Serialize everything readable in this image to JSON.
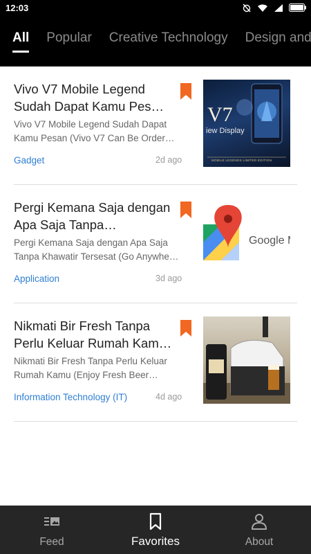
{
  "status_bar": {
    "time": "12:03"
  },
  "tabs": [
    {
      "label": "All",
      "active": true
    },
    {
      "label": "Popular",
      "active": false
    },
    {
      "label": "Creative Technology",
      "active": false
    },
    {
      "label": "Design and",
      "active": false
    }
  ],
  "articles": [
    {
      "title": "Vivo V7 Mobile Legend Sudah Dapat Kamu Pes…",
      "description": "Vivo V7 Mobile Legend Sudah Dapat Kamu Pesan (Vivo V7 Can Be Order…",
      "category": "Gadget",
      "age": "2d ago",
      "thumb_text": "V7",
      "thumb_subtext": "iew Display",
      "thumb_caption": "MOBILE LEGENDS LIMITED EDITION"
    },
    {
      "title": "Pergi Kemana Saja dengan Apa Saja Tanpa…",
      "description": "Pergi Kemana Saja dengan Apa Saja Tanpa Khawatir Tersesat (Go Anywhe…",
      "category": "Application",
      "age": "3d ago",
      "thumb_text": "Google M"
    },
    {
      "title": "Nikmati Bir Fresh Tanpa Perlu Keluar Rumah Kam…",
      "description": "Nikmati Bir Fresh Tanpa Perlu Keluar Rumah Kamu (Enjoy Fresh Beer…",
      "category": "Information Technology (IT)",
      "age": "4d ago"
    }
  ],
  "bottom_nav": [
    {
      "label": "Feed",
      "icon": "feed-icon",
      "active": false
    },
    {
      "label": "Favorites",
      "icon": "bookmark-icon",
      "active": true
    },
    {
      "label": "About",
      "icon": "person-icon",
      "active": false
    }
  ],
  "colors": {
    "bookmark": "#f26722",
    "category_link": "#2f7fd3",
    "bar_background": "#000000",
    "bottom_nav_background": "#262626"
  }
}
